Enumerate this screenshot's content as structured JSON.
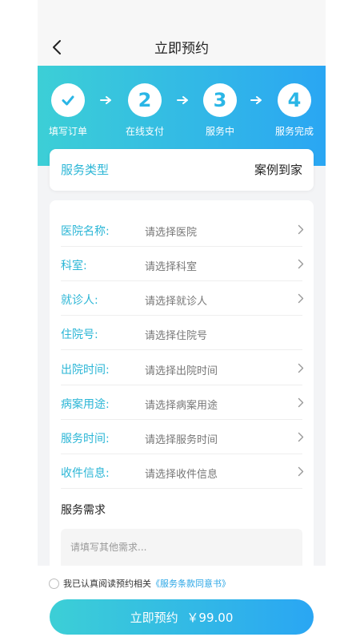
{
  "nav": {
    "title": "立即预约",
    "back_icon": "chevron-left-icon"
  },
  "steps": [
    {
      "number": "✓",
      "label": "填写订单",
      "state": "done"
    },
    {
      "number": "2",
      "label": "在线支付",
      "state": "pending"
    },
    {
      "number": "3",
      "label": "服务中",
      "state": "pending"
    },
    {
      "number": "4",
      "label": "服务完成",
      "state": "pending"
    }
  ],
  "service_type": {
    "label": "服务类型",
    "value": "案例到家"
  },
  "form": {
    "rows": [
      {
        "label": "医院名称:",
        "value": "请选择医院",
        "has_chevron": true
      },
      {
        "label": "科室:",
        "value": "请选择科室",
        "has_chevron": true
      },
      {
        "label": "就诊人:",
        "value": "请选择就诊人",
        "has_chevron": true
      },
      {
        "label": "住院号:",
        "value": "请选择住院号",
        "has_chevron": false
      },
      {
        "label": "出院时间:",
        "value": "请选择出院时间",
        "has_chevron": true
      },
      {
        "label": "病案用途:",
        "value": "请选择病案用途",
        "has_chevron": true
      },
      {
        "label": "服务时间:",
        "value": "请选择服务时间",
        "has_chevron": true
      },
      {
        "label": "收件信息:",
        "value": "请选择收件信息",
        "has_chevron": true
      }
    ],
    "need_title": "服务需求",
    "need_placeholder": "请填写其他需求..."
  },
  "agreement": {
    "text": "我已认真阅读预约相关",
    "link": "《服务条款同意书》",
    "checked": false
  },
  "submit": {
    "label": "立即预约",
    "price": "￥99.00"
  },
  "colors": {
    "accent": "#2bb6d6",
    "gradient_start": "#3ccfd6",
    "gradient_end": "#2aa6f3",
    "link": "#2aa6e6"
  }
}
